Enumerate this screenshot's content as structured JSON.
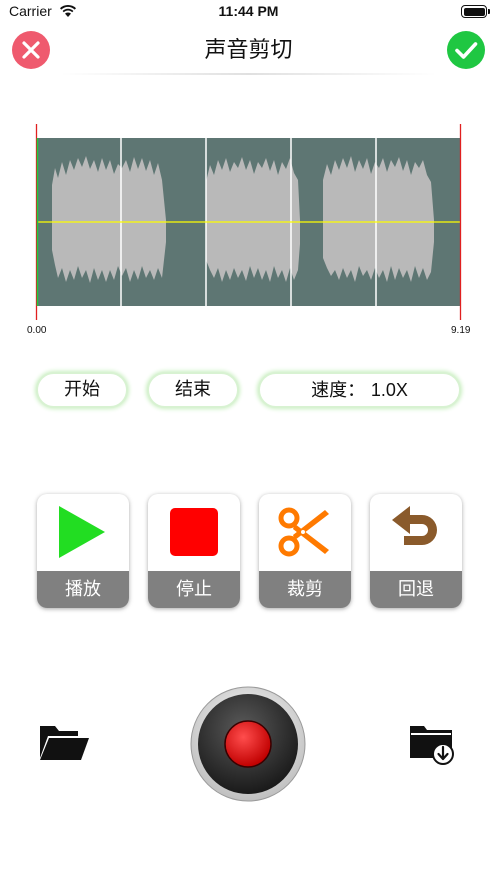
{
  "status_bar": {
    "carrier": "Carrier",
    "time": "11:44 PM",
    "wifi_icon": "wifi-icon",
    "battery_icon": "battery-icon",
    "battery_level": 1.0
  },
  "nav": {
    "title": "声音剪切",
    "close_icon": "close-icon",
    "confirm_icon": "checkmark-icon",
    "close_color": "#ef5a6e",
    "confirm_color": "#1fc742"
  },
  "waveform": {
    "start_time": "0.00",
    "end_time": "9.19",
    "background_color": "#5e7673",
    "wave_color": "#b9b9b9",
    "center_line_color": "#ffff00",
    "start_marker_color": "#1fc742",
    "end_marker_color": "#e02020"
  },
  "controls": {
    "start_label": "开始",
    "end_label": "结束",
    "speed_label": "速度：",
    "speed_value": "1.0X",
    "accent_color": "#c9efc0"
  },
  "actions": [
    {
      "label": "播放",
      "icon": "play-icon",
      "color": "#22dd22"
    },
    {
      "label": "停止",
      "icon": "stop-icon",
      "color": "#ff0000"
    },
    {
      "label": "裁剪",
      "icon": "scissors-icon",
      "color": "#ff7a00"
    },
    {
      "label": "回退",
      "icon": "undo-icon",
      "color": "#8a5a2b"
    }
  ],
  "bottom_bar": {
    "open_icon": "folder-open-icon",
    "record_icon": "record-icon",
    "save_icon": "folder-download-icon",
    "record_color": "#e01c1c"
  }
}
